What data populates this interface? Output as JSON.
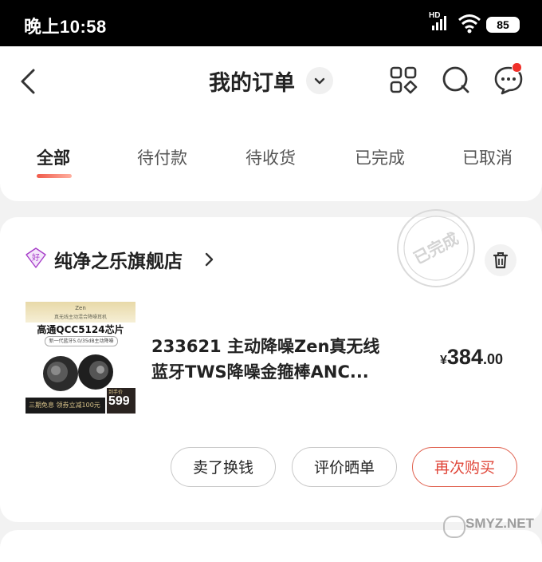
{
  "status_bar": {
    "time": "晚上10:58",
    "network_label": "HD",
    "battery": "85",
    "icons": [
      "signal-icon",
      "wifi-icon",
      "battery-icon"
    ]
  },
  "header": {
    "title": "我的订单",
    "icons": [
      "back-icon",
      "chevron-down-icon",
      "grid-icon",
      "search-icon",
      "message-icon"
    ]
  },
  "tabs": [
    {
      "label": "全部",
      "active": true
    },
    {
      "label": "待付款",
      "active": false
    },
    {
      "label": "待收货",
      "active": false
    },
    {
      "label": "已完成",
      "active": false
    },
    {
      "label": "已取消",
      "active": false
    }
  ],
  "order": {
    "shop_badge": "好",
    "shop_name": "纯净之乐旗舰店",
    "status_stamp": "已完成",
    "product": {
      "image": {
        "brand": "Zen",
        "subtitle": "真无线主动混合降噪耳机",
        "headline": "高通QCC5124芯片",
        "pill": "新一代蓝牙5.0/35dB主动降噪",
        "promo": "三期免息 领券立减100元",
        "price_label": "到手价",
        "price": "599"
      },
      "title_line1": "233621 主动降噪Zen真无线",
      "title_line2": "蓝牙TWS降噪金箍棒ANC..."
    },
    "price": {
      "currency": "¥",
      "integer": "384",
      "decimal": ".00"
    },
    "actions": [
      "卖了换钱",
      "评价晒单",
      "再次购买"
    ]
  },
  "colors": {
    "accent": "#e0473a",
    "badge_dot": "#f0302a",
    "shop_badge": "#a63cc8"
  },
  "watermark": "SMYZ.NET"
}
